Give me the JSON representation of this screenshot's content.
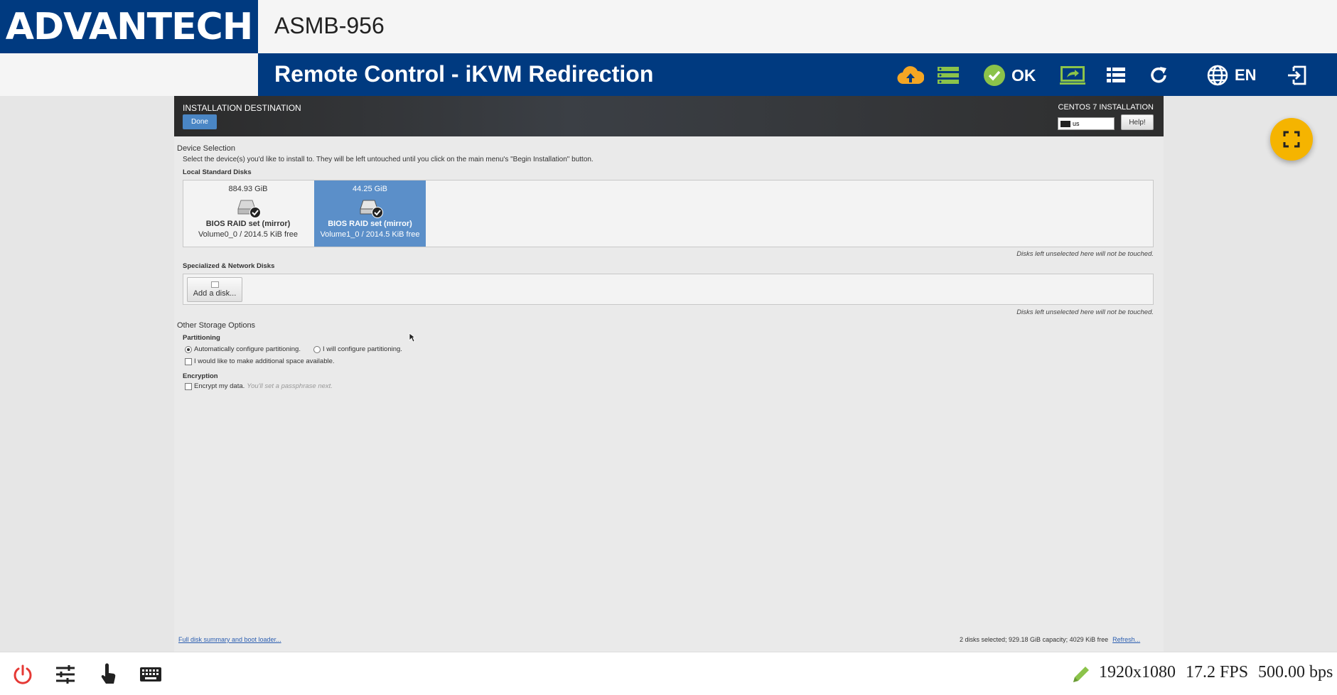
{
  "brand": {
    "logo_text": "ADVANTECH",
    "color": "#003a80"
  },
  "device": {
    "name": "ASMB-956"
  },
  "titlebar": {
    "title": "Remote Control - iKVM Redirection",
    "icons": [
      "cloud-upload-icon",
      "server-list-icon",
      "check-circle-icon",
      "screen-share-icon",
      "list-icon",
      "refresh-icon",
      "globe-icon",
      "logout-icon"
    ],
    "status_label": "OK",
    "language": "EN"
  },
  "installer": {
    "header_title": "INSTALLATION DESTINATION",
    "done_label": "Done",
    "product_title": "CENTOS 7 INSTALLATION",
    "keyboard_layout": "us",
    "help_label": "Help!",
    "device_selection": "Device Selection",
    "instructions": "Select the device(s) you'd like to install to.  They will be left untouched until you click on the main menu's \"Begin Installation\" button.",
    "local_disks_label": "Local Standard Disks",
    "disks": [
      {
        "size": "884.93 GiB",
        "name": "BIOS RAID set (mirror)",
        "volume": "Volume0_0",
        "sep": "/",
        "free": "2014.5 KiB free",
        "selected": true
      },
      {
        "size": "44.25 GiB",
        "name": "BIOS RAID set (mirror)",
        "volume": "Volume1_0",
        "sep": "/",
        "free": "2014.5 KiB free",
        "selected": true
      }
    ],
    "untouched_note": "Disks left unselected here will not be touched.",
    "network_disks_label": "Specialized & Network Disks",
    "add_disk_label": "Add a disk...",
    "other_options": "Other Storage Options",
    "partitioning_label": "Partitioning",
    "auto_partition": "Automatically configure partitioning.",
    "manual_partition": "I will configure partitioning.",
    "additional_space": "I would like to make additional space available.",
    "encryption_label": "Encryption",
    "encrypt_data": "Encrypt my data.",
    "encrypt_hint": "You'll set a passphrase next.",
    "summary_link": "Full disk summary and boot loader...",
    "status_summary": "2 disks selected; 929.18 GiB capacity; 4029 KiB free",
    "refresh_link": "Refresh..."
  },
  "footer": {
    "icons": [
      "power-icon",
      "settings-sliders-icon",
      "touch-icon",
      "keyboard-icon",
      "pencil-icon"
    ],
    "resolution": "1920x1080",
    "fps": "17.2 FPS",
    "bitrate": "500.00 bps"
  },
  "colors": {
    "accent": "#f5b400",
    "selected_disk": "#5b8fc9",
    "power": "#e53935",
    "ok": "#8bc34a"
  }
}
